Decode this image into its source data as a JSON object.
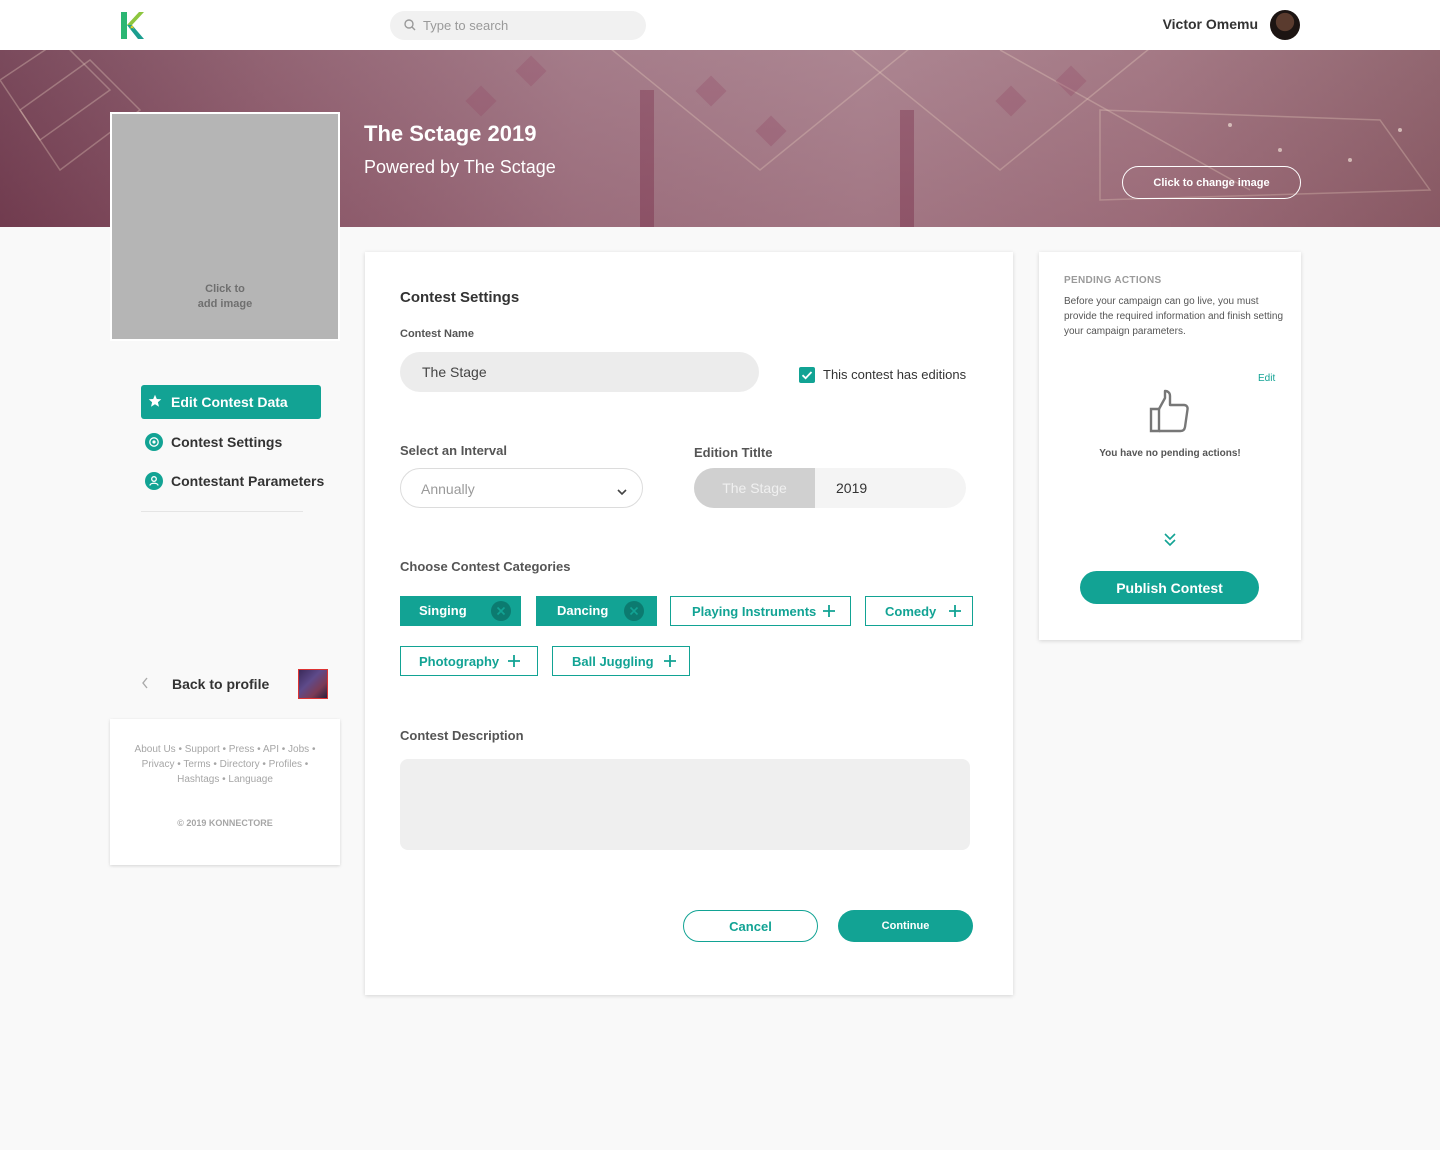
{
  "header": {
    "search_placeholder": "Type to search",
    "user_name": "Victor Omemu"
  },
  "banner": {
    "title": "The Sctage 2019",
    "subtitle": "Powered by The Sctage",
    "change_image_label": "Click to change image"
  },
  "image_box": {
    "line1": "Click to",
    "line2": "add image"
  },
  "sidebar": {
    "items": [
      {
        "label": "Edit Contest Data",
        "active": true,
        "icon": "star-icon"
      },
      {
        "label": "Contest Settings",
        "active": false,
        "icon": "settings-icon"
      },
      {
        "label": "Contestant Parameters",
        "active": false,
        "icon": "user-icon"
      }
    ],
    "back_label": "Back to profile"
  },
  "footer": {
    "links": "About Us • Support • Press • API • Jobs • Privacy • Terms • Directory • Profiles • Hashtags • Language",
    "copyright": "© 2019 KONNECTORE"
  },
  "form": {
    "section_title": "Contest Settings",
    "contest_name_label": "Contest Name",
    "contest_name_value": "The Stage",
    "editions_checkbox_label": "This contest has editions",
    "editions_checked": true,
    "interval_label": "Select an Interval",
    "interval_value": "Annually",
    "edition_title_label": "Edition Titlte",
    "edition_prefix": "The Stage",
    "edition_value": "2019",
    "categories_label": "Choose Contest Categories",
    "categories": [
      {
        "label": "Singing",
        "selected": true
      },
      {
        "label": "Dancing",
        "selected": true
      },
      {
        "label": "Playing Instruments",
        "selected": false
      },
      {
        "label": "Comedy",
        "selected": false
      },
      {
        "label": "Photography",
        "selected": false
      },
      {
        "label": "Ball Juggling",
        "selected": false
      }
    ],
    "description_label": "Contest Description",
    "description_value": "",
    "cancel_label": "Cancel",
    "continue_label": "Continue"
  },
  "pending": {
    "title": "PENDING ACTIONS",
    "description": "Before your campaign can go live, you must provide the required information and finish setting your campaign parameters.",
    "edit_label": "Edit",
    "empty_message": "You have no pending actions!",
    "publish_label": "Publish Contest"
  },
  "colors": {
    "accent": "#12a394",
    "accent_dark": "#0c7b70",
    "background": "#f9f9f9"
  }
}
